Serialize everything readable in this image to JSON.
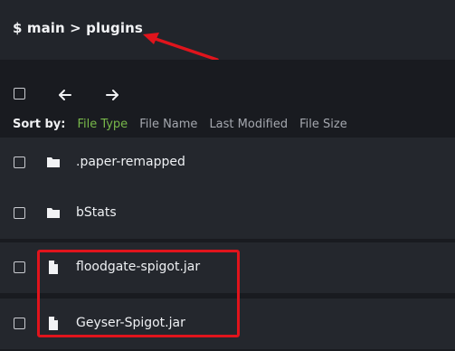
{
  "header": {
    "path": "$ main > plugins"
  },
  "toolbar": {
    "back_icon": "arrow-left-icon",
    "forward_icon": "arrow-right-icon"
  },
  "sort": {
    "label": "Sort by:",
    "options": [
      "File Type",
      "File Name",
      "Last Modified",
      "File Size"
    ],
    "active": "File Type"
  },
  "files": [
    {
      "name": ".paper-remapped",
      "type": "folder",
      "icon": "folder-icon"
    },
    {
      "name": "bStats",
      "type": "folder",
      "icon": "folder-icon"
    },
    {
      "name": "floodgate-spigot.jar",
      "type": "file",
      "icon": "file-icon"
    },
    {
      "name": "Geyser-Spigot.jar",
      "type": "file",
      "icon": "file-icon"
    }
  ],
  "colors": {
    "active_sort": "#78b84a",
    "annotation": "#e0141c",
    "row_bg": "#24272d",
    "page_bg": "#191b20"
  }
}
